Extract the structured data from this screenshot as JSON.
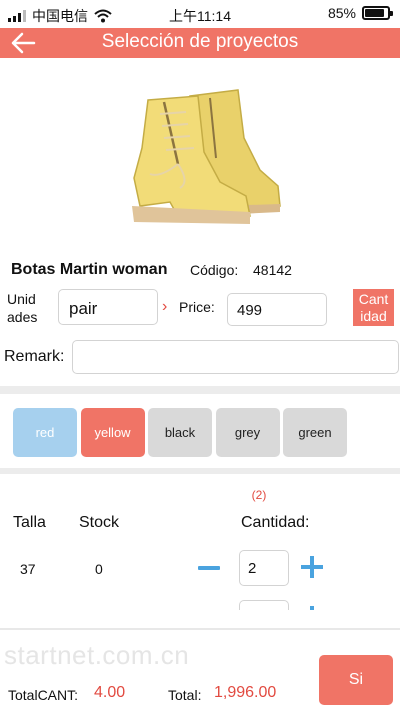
{
  "status_bar": {
    "carrier": "中国电信",
    "time": "上午11:14",
    "battery": "85%",
    "battery_level": 0.85
  },
  "header": {
    "title": "Selección de proyectos",
    "back_icon": "arrow-left-icon"
  },
  "product": {
    "image_icon": "yellow-boots-image",
    "name": "Botas Martin woman",
    "code_label": "Código:",
    "code_value": "48142"
  },
  "form": {
    "units_label": "Unid ades",
    "units_value": "pair",
    "price_label": "Price:",
    "price_value": "499",
    "quantity_badge": "Cant idad",
    "remark_label": "Remark:",
    "remark_value": ""
  },
  "colors": {
    "options": [
      {
        "label": "red",
        "bg": "#a6d0ee",
        "fg": "#ffffff",
        "state": "highlighted"
      },
      {
        "label": "yellow",
        "bg": "#f07466",
        "fg": "#ffffff",
        "state": "selected"
      },
      {
        "label": "black",
        "bg": "#d9d9d9",
        "fg": "#222222",
        "state": "default"
      },
      {
        "label": "grey",
        "bg": "#d9d9d9",
        "fg": "#222222",
        "state": "default"
      },
      {
        "label": "green",
        "bg": "#d9d9d9",
        "fg": "#222222",
        "state": "default"
      }
    ]
  },
  "sizes": {
    "quantity_summary": "(2)",
    "headers": {
      "size": "Talla",
      "stock": "Stock",
      "quantity": "Cantidad:"
    },
    "rows": [
      {
        "size": "37",
        "stock": "0",
        "quantity": "2"
      }
    ]
  },
  "footer": {
    "watermark": "startnet.com.cn",
    "total_cant_label": "TotalCANT:",
    "total_cant_value": "4.00",
    "total_label": "Total:",
    "total_value": "1,996.00",
    "confirm_label": "Si"
  },
  "theme": {
    "accent": "#f07466",
    "stepper": "#4aa3df",
    "value_red": "#e24a40"
  }
}
